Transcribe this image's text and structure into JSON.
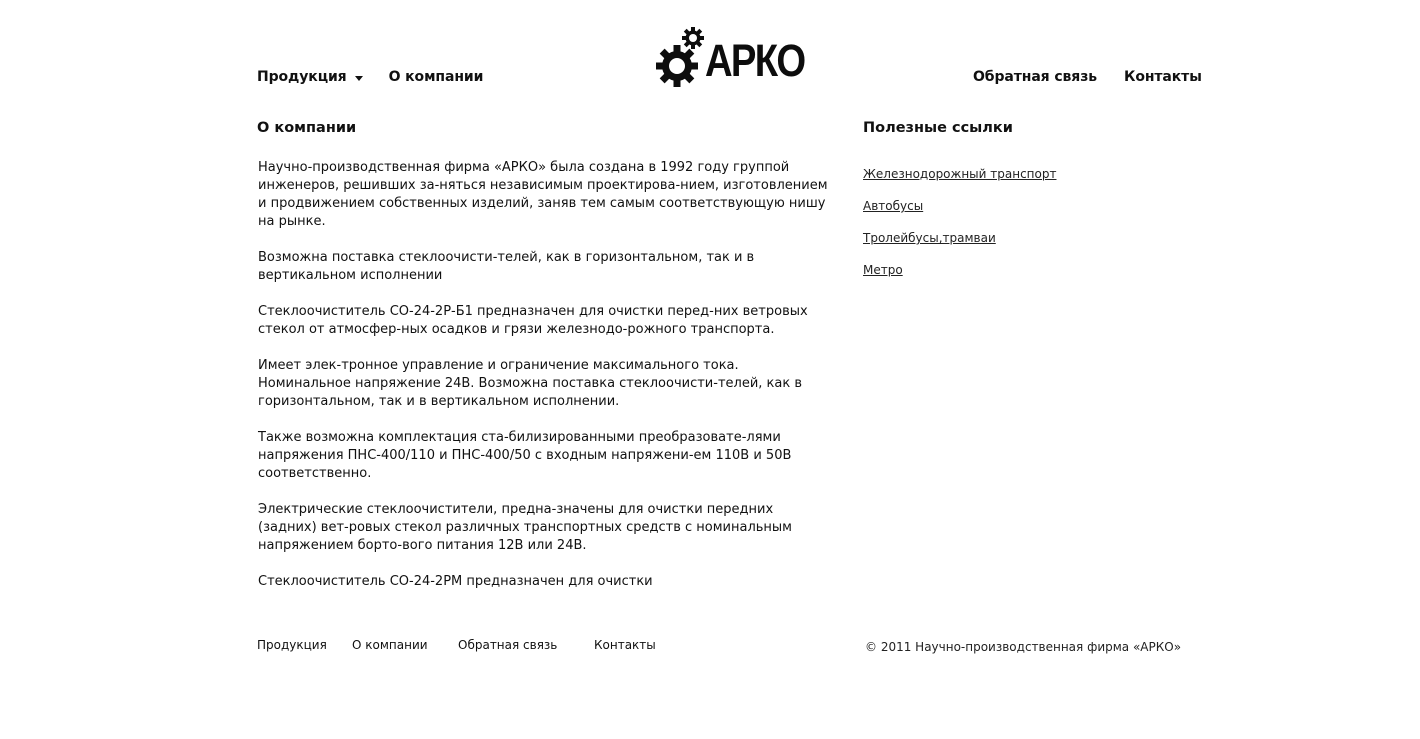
{
  "header": {
    "nav_left": {
      "products": "Продукция",
      "about": "О компании"
    },
    "nav_right": {
      "feedback": "Обратная связь",
      "contacts": "Контакты"
    },
    "logo_text": "АРКО"
  },
  "main": {
    "title": "О компании",
    "paragraphs": [
      "Научно-производственная фирма «АРКО» была создана в 1992 году группой инженеров, решивших за-няться независимым проектирова-нием, изготовлением и продвижением собственных изделий, заняв тем самым соответствующую нишу на рынке.",
      "Возможна поставка стеклоочисти-телей, как в горизонтальном, так и в вертикальном исполнении",
      "Стеклоочиститель СО-24-2Р-Б1 предназначен для очистки перед-них ветровых стекол от атмосфер-ных осадков и грязи железнодо-рожного транспорта.",
      "Имеет элек-тронное управление и ограничение максимального тока. Номинальное напряжение 24В. Возможна поставка стеклоочисти-телей, как в горизонтальном, так и в вертикальном исполнении.",
      "Также возможна комплектация ста-билизированными преобразовате-лями напряжения ПНС-400/110 и ПНС-400/50 с входным напряжени-ем 110В и 50В соответственно.",
      "Электрические стеклоочистители, предна-значены для очистки передних (задних) вет-ровых стекол различных транспортных средств с номинальным напряжением борто-вого питания 12В или 24В.",
      "Стеклоочиститель СО-24-2РМ предназначен для очистки"
    ]
  },
  "sidebar": {
    "title": "Полезные ссылки",
    "links": [
      "Железнодорожный транспорт",
      "Автобусы",
      "Тролейбусы,трамваи",
      "Метро"
    ]
  },
  "footer": {
    "products": "Продукция",
    "about": "О компании",
    "feedback": "Обратная связь",
    "contacts": "Контакты",
    "copyright": "© 2011 Научно-производственная фирма «АРКО»"
  }
}
